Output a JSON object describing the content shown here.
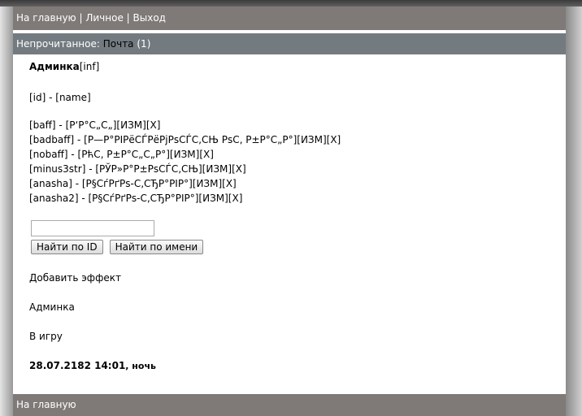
{
  "nav": {
    "home": "На главную",
    "sep": "|",
    "personal": "Личное",
    "exit": "Выход"
  },
  "unread": {
    "label": "Непрочитанное:",
    "mail": "Почта",
    "count": "(1)"
  },
  "admin": {
    "title": "Админка",
    "inf": "[inf]"
  },
  "header_row": "[id] - [name]",
  "effects": [
    {
      "id": "[baff]",
      "name": "[Р‘Р°С„С„]"
    },
    {
      "id": "[badbaff]",
      "name": "[Р—Р°РІРёСЃРёРјРѕСЃС‚СЊ РѕС‚ Р±Р°С„Р°]"
    },
    {
      "id": "[nobaff]",
      "name": "[РћС‚ Р±Р°С„С„Р°]"
    },
    {
      "id": "[minus3str]",
      "name": "[РЎР»Р°Р±РѕСЃС‚СЊ]"
    },
    {
      "id": "[anasha]",
      "name": "[Р§СѓРґРѕ-С‚СЂР°РІР°]"
    },
    {
      "id": "[anasha2]",
      "name": "[Р§СѓРґРѕ-С‚СЂР°РІР°]"
    }
  ],
  "edit_label": "[ИЗМ]",
  "delete_label": "[X]",
  "dash": " - ",
  "search": {
    "value": "",
    "find_id": "Найти по ID",
    "find_name": "Найти по имени"
  },
  "links": {
    "add_effect": "Добавить эффект",
    "admin": "Админка",
    "to_game": "В игру"
  },
  "datetime": "28.07.2182 14:01",
  "daytime": ", ночь",
  "footer": {
    "home": "На главную"
  }
}
